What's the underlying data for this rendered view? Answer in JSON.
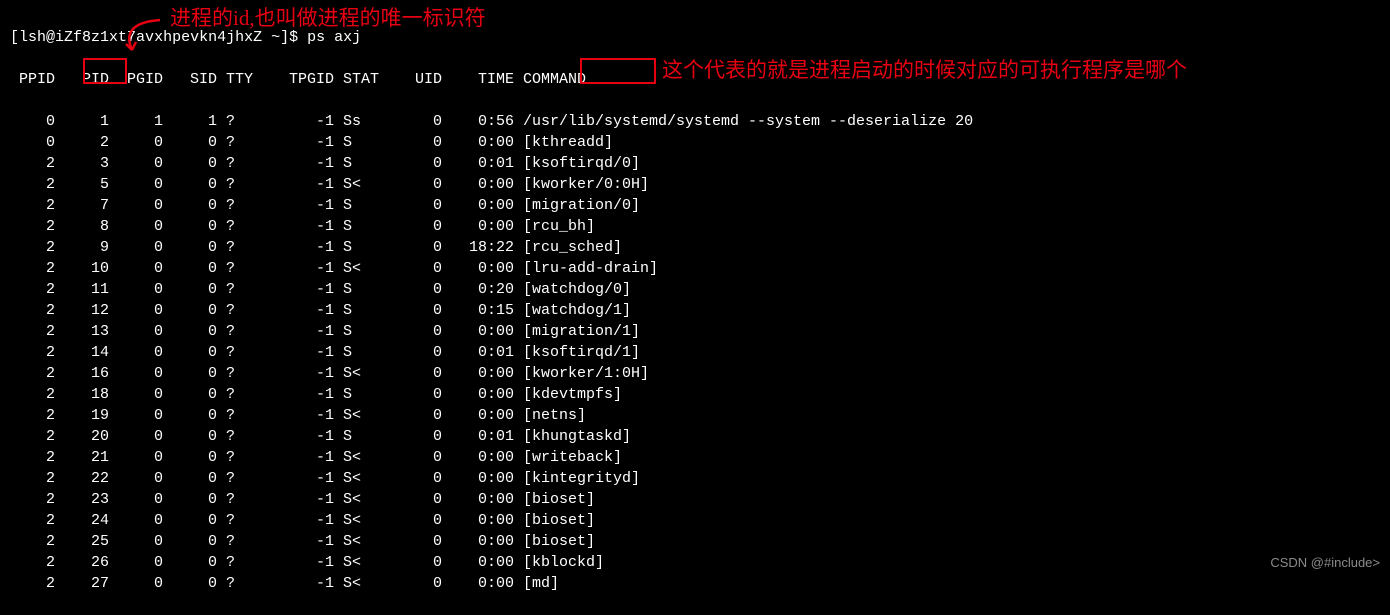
{
  "annotations": {
    "pid_note": "进程的id,也叫做进程的唯一标识符",
    "cmd_note": "这个代表的就是进程启动的时候对应的可执行程序是哪个"
  },
  "prompt": {
    "user": "lsh",
    "host": "iZf8z1xt7avxhpevkn4jhxZ",
    "path": "~",
    "command": "ps axj"
  },
  "headers": {
    "ppid": "PPID",
    "pid": "PID",
    "pgid": "PGID",
    "sid": "SID",
    "tty": "TTY",
    "tpgid": "TPGID",
    "stat": "STAT",
    "uid": "UID",
    "time": "TIME",
    "command": "COMMAND"
  },
  "rows": [
    {
      "ppid": "0",
      "pid": "1",
      "pgid": "1",
      "sid": "1",
      "tty": "?",
      "tpgid": "-1",
      "stat": "Ss",
      "uid": "0",
      "time": "0:56",
      "cmd": "/usr/lib/systemd/systemd --system --deserialize 20"
    },
    {
      "ppid": "0",
      "pid": "2",
      "pgid": "0",
      "sid": "0",
      "tty": "?",
      "tpgid": "-1",
      "stat": "S",
      "uid": "0",
      "time": "0:00",
      "cmd": "[kthreadd]"
    },
    {
      "ppid": "2",
      "pid": "3",
      "pgid": "0",
      "sid": "0",
      "tty": "?",
      "tpgid": "-1",
      "stat": "S",
      "uid": "0",
      "time": "0:01",
      "cmd": "[ksoftirqd/0]"
    },
    {
      "ppid": "2",
      "pid": "5",
      "pgid": "0",
      "sid": "0",
      "tty": "?",
      "tpgid": "-1",
      "stat": "S<",
      "uid": "0",
      "time": "0:00",
      "cmd": "[kworker/0:0H]"
    },
    {
      "ppid": "2",
      "pid": "7",
      "pgid": "0",
      "sid": "0",
      "tty": "?",
      "tpgid": "-1",
      "stat": "S",
      "uid": "0",
      "time": "0:00",
      "cmd": "[migration/0]"
    },
    {
      "ppid": "2",
      "pid": "8",
      "pgid": "0",
      "sid": "0",
      "tty": "?",
      "tpgid": "-1",
      "stat": "S",
      "uid": "0",
      "time": "0:00",
      "cmd": "[rcu_bh]"
    },
    {
      "ppid": "2",
      "pid": "9",
      "pgid": "0",
      "sid": "0",
      "tty": "?",
      "tpgid": "-1",
      "stat": "S",
      "uid": "0",
      "time": "18:22",
      "cmd": "[rcu_sched]"
    },
    {
      "ppid": "2",
      "pid": "10",
      "pgid": "0",
      "sid": "0",
      "tty": "?",
      "tpgid": "-1",
      "stat": "S<",
      "uid": "0",
      "time": "0:00",
      "cmd": "[lru-add-drain]"
    },
    {
      "ppid": "2",
      "pid": "11",
      "pgid": "0",
      "sid": "0",
      "tty": "?",
      "tpgid": "-1",
      "stat": "S",
      "uid": "0",
      "time": "0:20",
      "cmd": "[watchdog/0]"
    },
    {
      "ppid": "2",
      "pid": "12",
      "pgid": "0",
      "sid": "0",
      "tty": "?",
      "tpgid": "-1",
      "stat": "S",
      "uid": "0",
      "time": "0:15",
      "cmd": "[watchdog/1]"
    },
    {
      "ppid": "2",
      "pid": "13",
      "pgid": "0",
      "sid": "0",
      "tty": "?",
      "tpgid": "-1",
      "stat": "S",
      "uid": "0",
      "time": "0:00",
      "cmd": "[migration/1]"
    },
    {
      "ppid": "2",
      "pid": "14",
      "pgid": "0",
      "sid": "0",
      "tty": "?",
      "tpgid": "-1",
      "stat": "S",
      "uid": "0",
      "time": "0:01",
      "cmd": "[ksoftirqd/1]"
    },
    {
      "ppid": "2",
      "pid": "16",
      "pgid": "0",
      "sid": "0",
      "tty": "?",
      "tpgid": "-1",
      "stat": "S<",
      "uid": "0",
      "time": "0:00",
      "cmd": "[kworker/1:0H]"
    },
    {
      "ppid": "2",
      "pid": "18",
      "pgid": "0",
      "sid": "0",
      "tty": "?",
      "tpgid": "-1",
      "stat": "S",
      "uid": "0",
      "time": "0:00",
      "cmd": "[kdevtmpfs]"
    },
    {
      "ppid": "2",
      "pid": "19",
      "pgid": "0",
      "sid": "0",
      "tty": "?",
      "tpgid": "-1",
      "stat": "S<",
      "uid": "0",
      "time": "0:00",
      "cmd": "[netns]"
    },
    {
      "ppid": "2",
      "pid": "20",
      "pgid": "0",
      "sid": "0",
      "tty": "?",
      "tpgid": "-1",
      "stat": "S",
      "uid": "0",
      "time": "0:01",
      "cmd": "[khungtaskd]"
    },
    {
      "ppid": "2",
      "pid": "21",
      "pgid": "0",
      "sid": "0",
      "tty": "?",
      "tpgid": "-1",
      "stat": "S<",
      "uid": "0",
      "time": "0:00",
      "cmd": "[writeback]"
    },
    {
      "ppid": "2",
      "pid": "22",
      "pgid": "0",
      "sid": "0",
      "tty": "?",
      "tpgid": "-1",
      "stat": "S<",
      "uid": "0",
      "time": "0:00",
      "cmd": "[kintegrityd]"
    },
    {
      "ppid": "2",
      "pid": "23",
      "pgid": "0",
      "sid": "0",
      "tty": "?",
      "tpgid": "-1",
      "stat": "S<",
      "uid": "0",
      "time": "0:00",
      "cmd": "[bioset]"
    },
    {
      "ppid": "2",
      "pid": "24",
      "pgid": "0",
      "sid": "0",
      "tty": "?",
      "tpgid": "-1",
      "stat": "S<",
      "uid": "0",
      "time": "0:00",
      "cmd": "[bioset]"
    },
    {
      "ppid": "2",
      "pid": "25",
      "pgid": "0",
      "sid": "0",
      "tty": "?",
      "tpgid": "-1",
      "stat": "S<",
      "uid": "0",
      "time": "0:00",
      "cmd": "[bioset]"
    },
    {
      "ppid": "2",
      "pid": "26",
      "pgid": "0",
      "sid": "0",
      "tty": "?",
      "tpgid": "-1",
      "stat": "S<",
      "uid": "0",
      "time": "0:00",
      "cmd": "[kblockd]"
    },
    {
      "ppid": "2",
      "pid": "27",
      "pgid": "0",
      "sid": "0",
      "tty": "?",
      "tpgid": "-1",
      "stat": "S<",
      "uid": "0",
      "time": "0:00",
      "cmd": "[md]"
    }
  ],
  "watermark": "CSDN @#include>"
}
